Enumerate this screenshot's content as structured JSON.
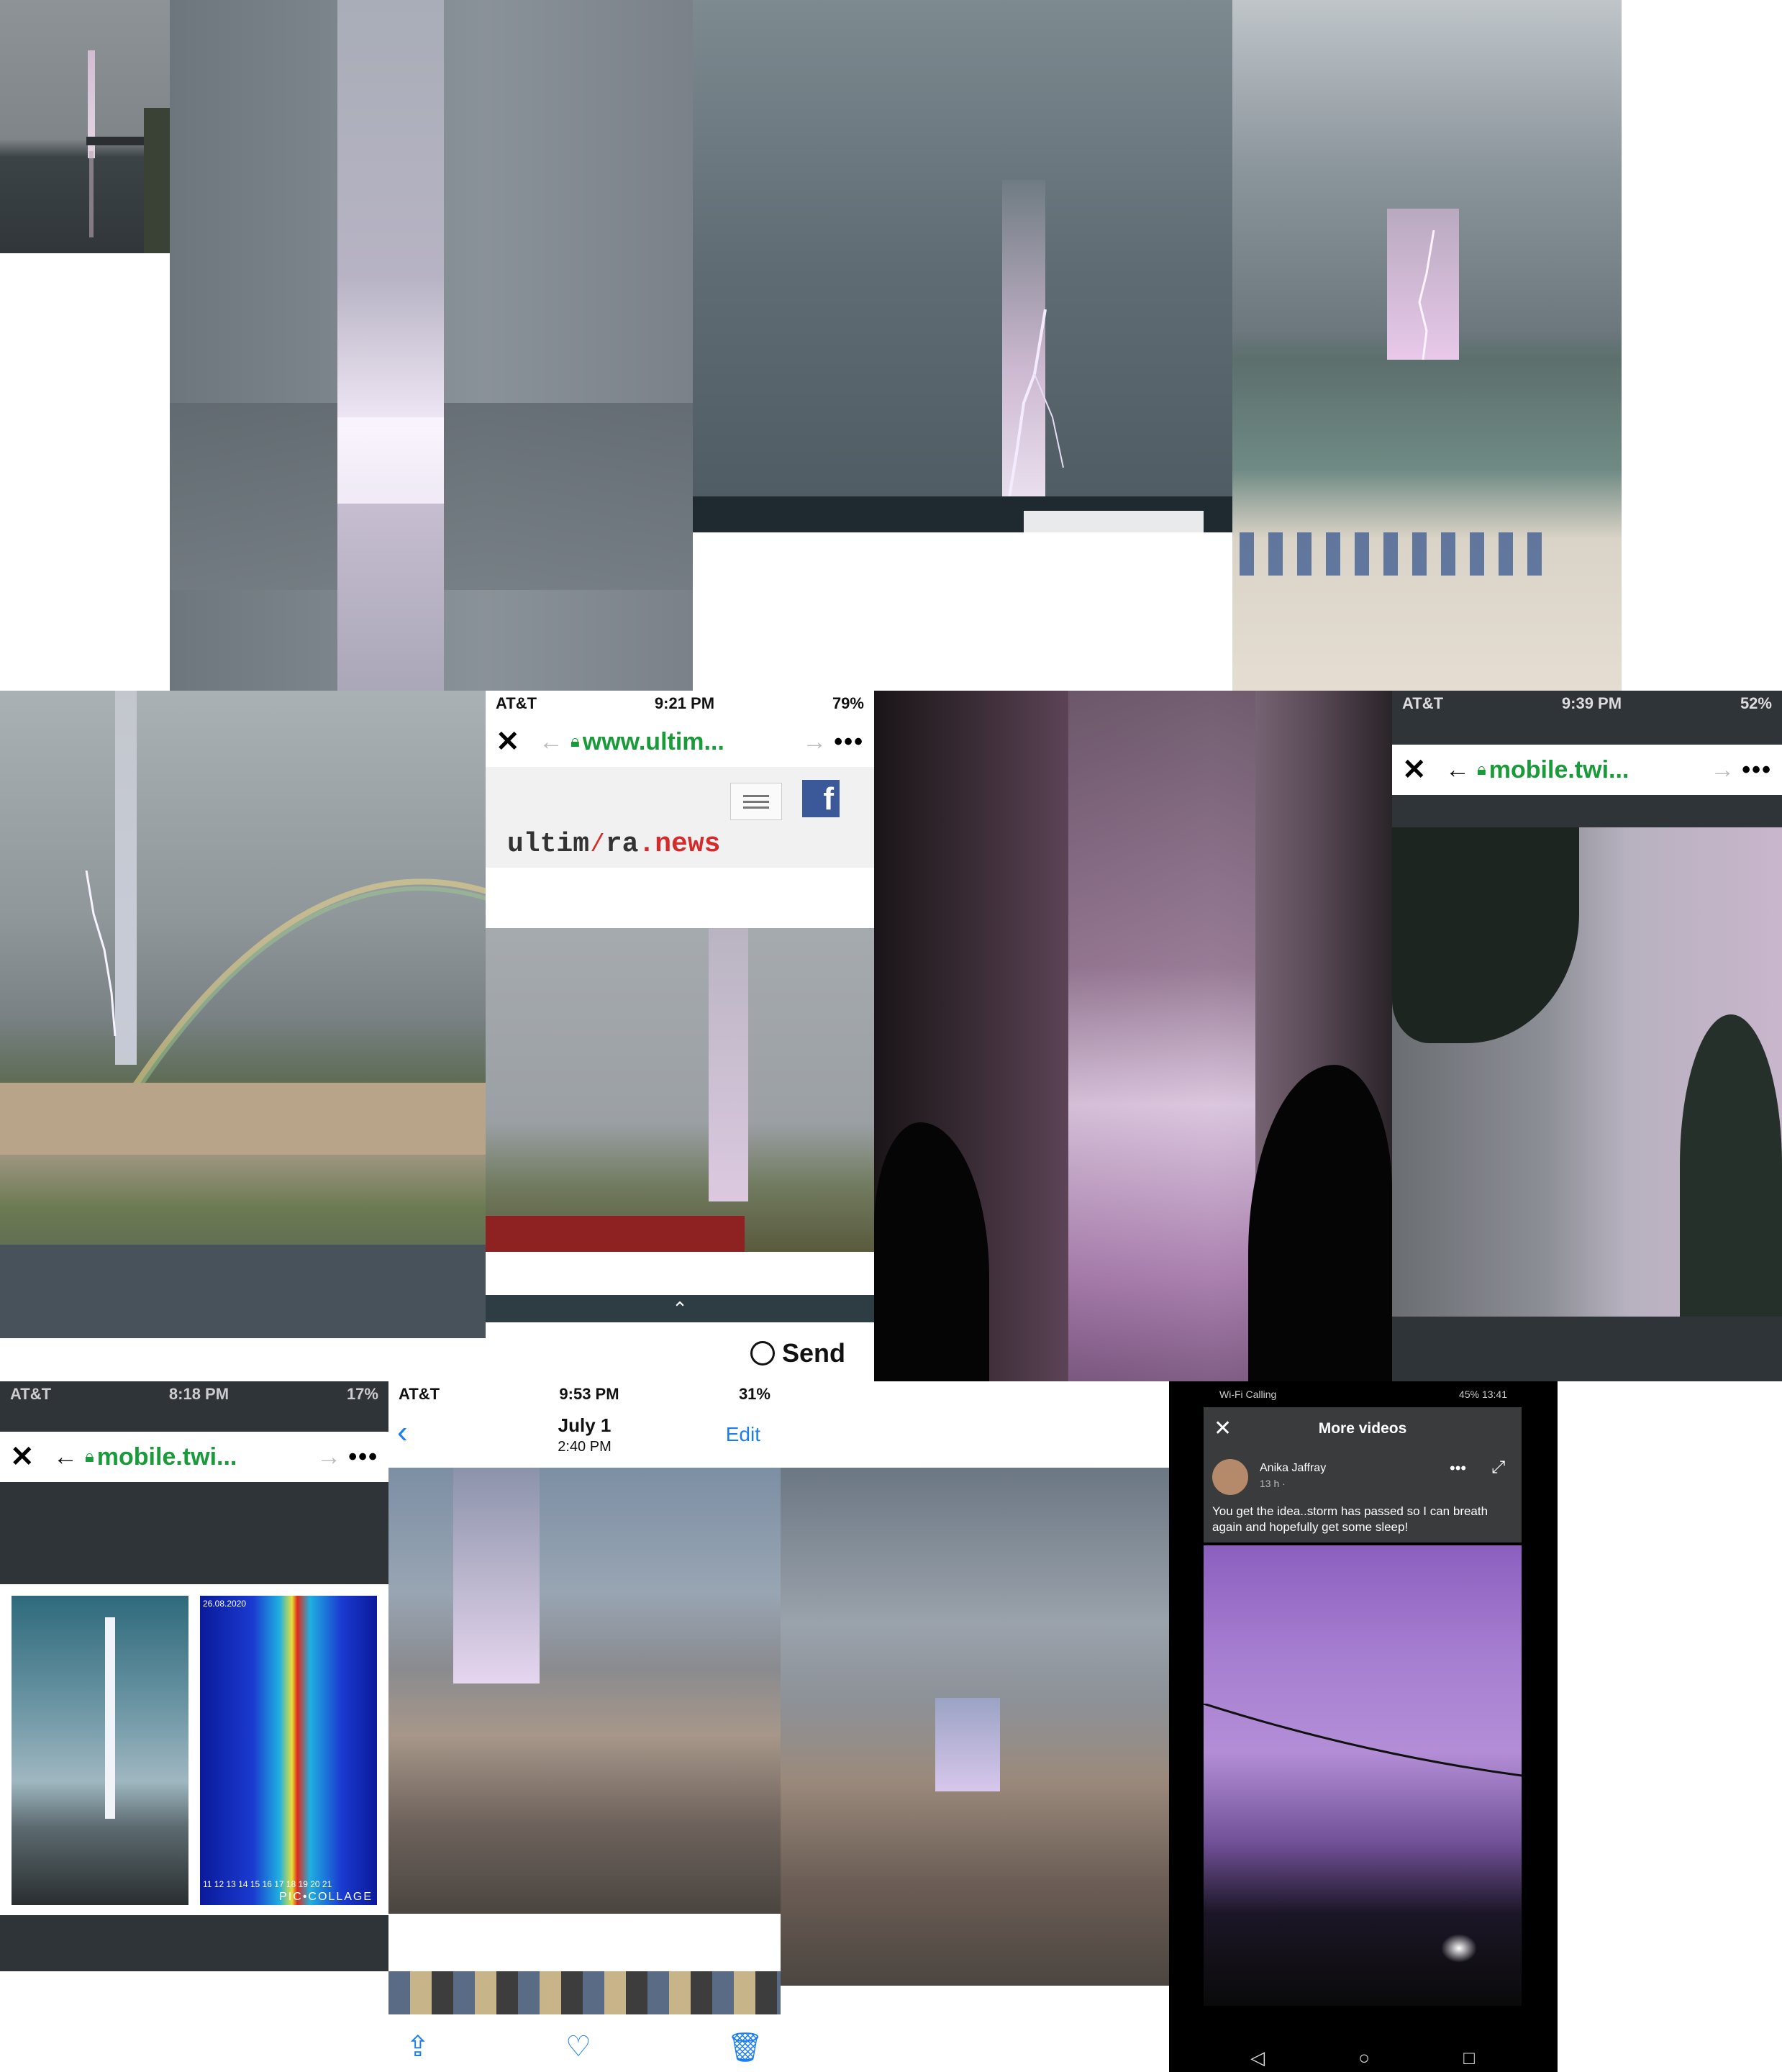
{
  "tile5": {
    "status": {
      "carrier": "AT&T",
      "time": "9:21 PM",
      "battery": "79%"
    },
    "url": "www.ultim...",
    "logo_part1": "ultim",
    "logo_part2": "ra",
    "logo_part3": ".news",
    "send_label": "Send"
  },
  "tile7": {
    "status": {
      "carrier": "AT&T",
      "time": "9:39 PM",
      "battery": "52%"
    },
    "url": "mobile.twi..."
  },
  "tile8": {
    "status": {
      "carrier": "AT&T",
      "time": "8:18 PM",
      "battery": "17%"
    },
    "url": "mobile.twi...",
    "spectro_date": "26.08.2020",
    "spectro_ticks": "11 12 13 14 15 16 17 18 19 20 21",
    "watermark": "PIC•COLLAGE"
  },
  "tile9": {
    "status": {
      "carrier": "AT&T",
      "time": "9:53 PM",
      "battery": "31%"
    },
    "date": "July 1",
    "time": "2:40 PM",
    "edit_label": "Edit"
  },
  "tile11": {
    "status": {
      "left": "Wi-Fi Calling",
      "right": "45% 13:41"
    },
    "title": "More videos",
    "author": "Anika Jaffray",
    "meta": "13 h ·",
    "caption": "You get the idea..storm has passed so I can breath again and hopefully get some sleep!"
  },
  "colors": {
    "accent_blue": "#1a7ef5",
    "url_green": "#1a9b3a",
    "facebook": "#3b5998",
    "purple_beam": "#c9a6e6"
  },
  "icons": [
    "close-icon",
    "back-arrow-icon",
    "forward-arrow-icon",
    "lock-icon",
    "more-icon",
    "menu-icon",
    "facebook-icon",
    "messenger-icon",
    "chevron-up-icon",
    "share-icon",
    "heart-icon",
    "trash-icon",
    "expand-icon"
  ]
}
